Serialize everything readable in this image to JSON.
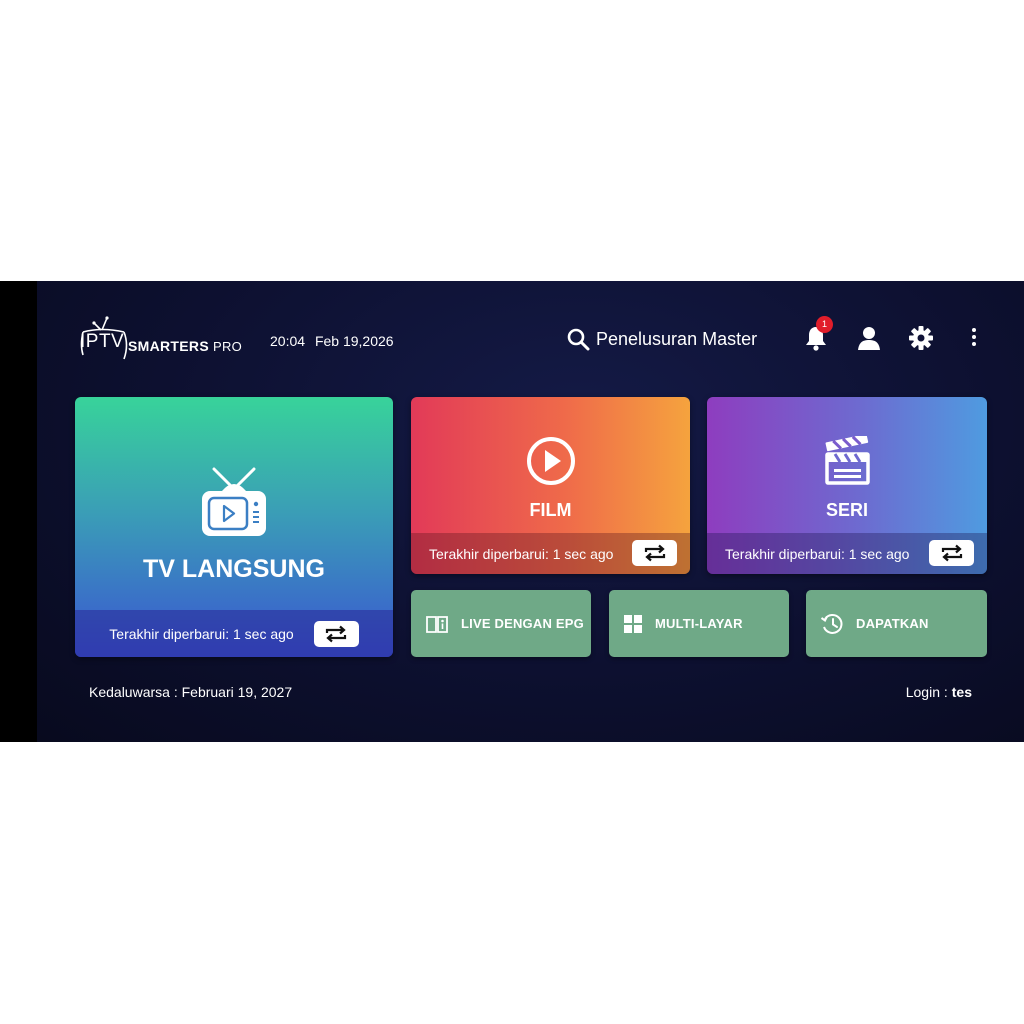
{
  "header": {
    "logo": {
      "prefix": "IPTV",
      "brand": "SMARTERS",
      "suffix": "PRO"
    },
    "time": "20:04",
    "date": "Feb 19,2026",
    "search_label": "Penelusuran Master",
    "notification_count": "1"
  },
  "tiles": {
    "live_tv": {
      "title": "TV LANGSUNG",
      "updated": "Terakhir diperbarui: 1 sec ago"
    },
    "film": {
      "title": "FILM",
      "updated": "Terakhir diperbarui: 1 sec ago"
    },
    "seri": {
      "title": "SERI",
      "updated": "Terakhir diperbarui: 1 sec ago"
    }
  },
  "shortcuts": [
    {
      "label": "LIVE DENGAN EPG",
      "icon": "epg-book-icon"
    },
    {
      "label": "MULTI-LAYAR",
      "icon": "grid-icon"
    },
    {
      "label": "DAPATKAN",
      "icon": "history-icon"
    }
  ],
  "footer": {
    "expiry": "Kedaluwarsa : Februari 19, 2027",
    "login_label": "Login :",
    "login_user": "tes"
  },
  "colors": {
    "background": "#0b0e26",
    "shortcut_green": "#6fa987",
    "badge_red": "#e11d2a"
  }
}
